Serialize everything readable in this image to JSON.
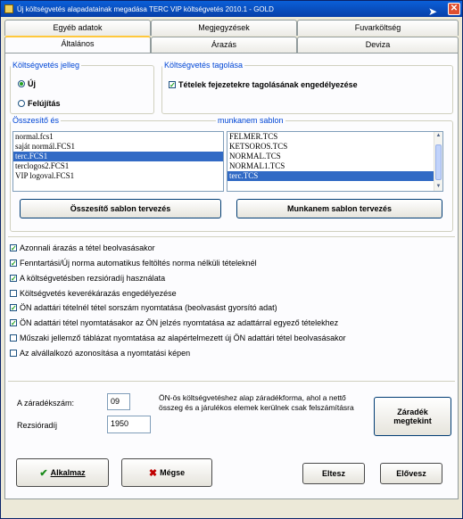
{
  "window": {
    "title": "Új költségvetés alapadatainak megadása   TERC VIP költségvetés 2010.1 - GOLD",
    "close_label": "✕"
  },
  "tabs_row1": [
    {
      "label": "Egyéb adatok"
    },
    {
      "label": "Megjegyzések"
    },
    {
      "label": "Fuvarköltség"
    }
  ],
  "tabs_row2": [
    {
      "label": "Általános",
      "active": true
    },
    {
      "label": "Árazás"
    },
    {
      "label": "Deviza"
    }
  ],
  "koltsegvetes_jelleg": {
    "label": "Költségvetés jelleg",
    "options": [
      {
        "label": "Új",
        "selected": true
      },
      {
        "label": "Felújítás",
        "selected": false
      }
    ]
  },
  "koltsegvetes_tagolasa": {
    "label": "Költségvetés tagolása",
    "checkbox_label": "Tételek fejezetekre tagolásának engedélyezése",
    "checked": true
  },
  "osszesito": {
    "label": "Összesítő és",
    "items": [
      "normal.fcs1",
      "saját normál.FCS1",
      "terc.FCS1",
      "terclogos2.FCS1",
      "VIP logoval.FCS1"
    ],
    "selected_index": 2,
    "button_label": "Összesítő sablon tervezés"
  },
  "munkanem": {
    "label": "munkanem sablon",
    "items": [
      "FELMER.TCS",
      "KETSOROS.TCS",
      "NORMAL.TCS",
      "NORMAL1.TCS",
      "terc.TCS"
    ],
    "selected_index": 4,
    "button_label": "Munkanem sablon tervezés"
  },
  "options": [
    {
      "label": "Azonnali árazás a tétel beolvasásakor",
      "checked": true
    },
    {
      "label": "Fenntartási/Új norma automatikus feltöltés norma nélküli tételeknél",
      "checked": true
    },
    {
      "label": "A költségvetésben rezsióradíj használata",
      "checked": true
    },
    {
      "label": "Költségvetés keverékárazás engedélyezése",
      "checked": false
    },
    {
      "label": "ÖN adattári tételnél tétel sorszám nyomtatása (beolvasást gyorsító adat)",
      "checked": true
    },
    {
      "label": "ÖN adattári tétel nyomtatásakor az ÖN jelzés nyomtatása az adattárral egyező tételekhez",
      "checked": true
    },
    {
      "label": "Műszaki jellemző táblázat nyomtatása az alapértelmezett új ÖN adattári tétel beolvasásakor",
      "checked": false
    },
    {
      "label": "Az alvállalkozó azonosítása a nyomtatási képen",
      "checked": false
    }
  ],
  "zaradek": {
    "szam_label": "A záradékszám:",
    "szam_value": "09",
    "rezsi_label": "Rezsióradíj",
    "rezsi_value": "1950",
    "note": "ÖN-ös költségvetéshez alap záradékforma, ahol a nettő összeg és a járulékos elemek kerülnek csak felszámításra",
    "button_label": "Záradék megtekint"
  },
  "footer": {
    "ok_label": "Alkalmaz",
    "cancel_label": "Mégse",
    "prev_label": "Eltesz",
    "next_label": "Elővesz",
    "ok_icon": "check-icon",
    "cancel_icon": "cross-icon"
  },
  "colors": {
    "titlebar": "#0a5fd8",
    "group_label": "#0046d5",
    "selection": "#316ac5"
  }
}
